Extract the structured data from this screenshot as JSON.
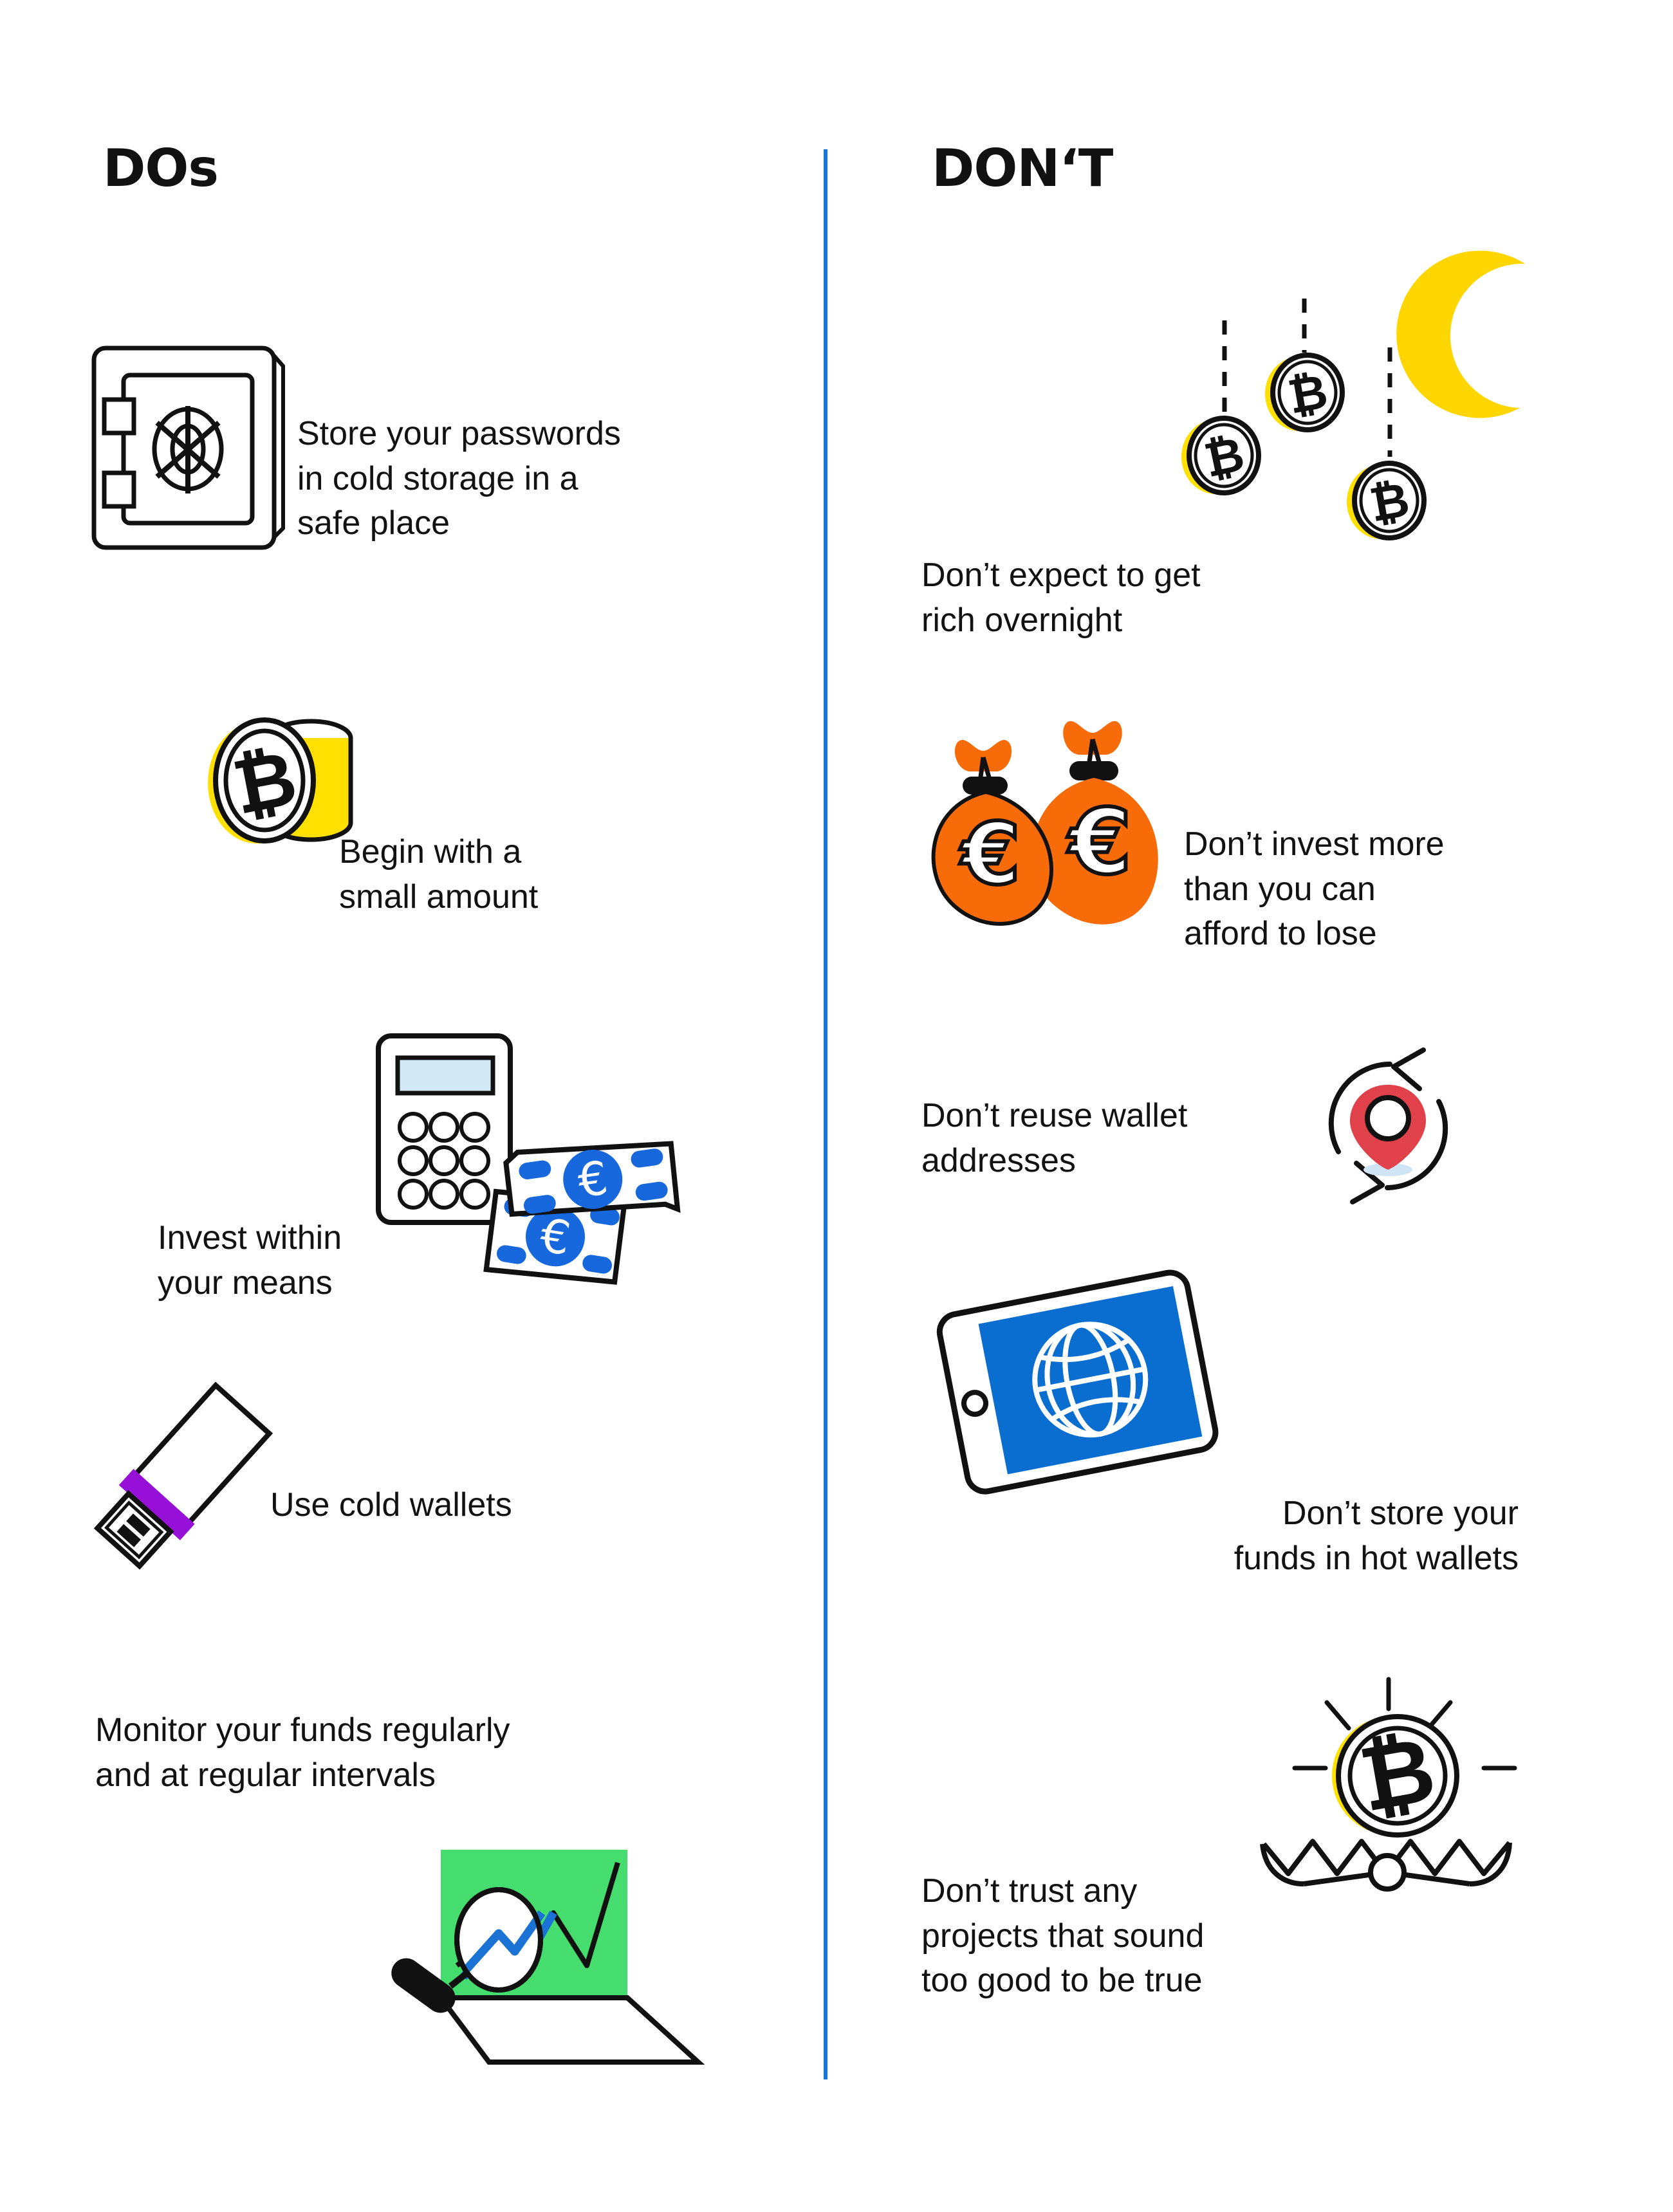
{
  "page": {
    "background": "#ffffff",
    "divider_color": "#1877d2"
  },
  "columns": {
    "left": {
      "title": "DOs"
    },
    "right": {
      "title": "DON‘T"
    }
  },
  "palette": {
    "bitcoin_yellow": "#ffe000",
    "moon_yellow": "#ffd600",
    "money_bag_orange": "#f76b09",
    "euro_blue": "#1668dc",
    "tablet_blue": "#0a6ed1",
    "chart_green": "#45dd6e",
    "chart_line_blue": "#1a73d4",
    "usb_purple": "#9610d8",
    "pin_red": "#e0414a",
    "calc_screen_blue": "#d3e9f5",
    "ink": "#121212"
  },
  "dos": [
    {
      "id": "store-passwords",
      "icon": "safe-icon",
      "text": "Store your passwords\nin cold storage in a\nsafe place"
    },
    {
      "id": "begin-small",
      "icon": "bitcoin-coin-stack-icon",
      "text": "Begin with a\nsmall amount"
    },
    {
      "id": "invest-within-means",
      "icon": "calculator-banknotes-icon",
      "text": "Invest within\nyour means"
    },
    {
      "id": "cold-wallets",
      "icon": "usb-drive-icon",
      "text": "Use cold wallets"
    },
    {
      "id": "monitor-funds",
      "icon": "laptop-chart-magnifier-icon",
      "text": "Monitor your funds regularly\nand at regular intervals"
    }
  ],
  "donts": [
    {
      "id": "rich-overnight",
      "icon": "falling-bitcoins-moon-icon",
      "text": "Don’t expect to get\nrich overnight"
    },
    {
      "id": "invest-more",
      "icon": "euro-money-bags-icon",
      "text": "Don’t invest more\nthan you can\nafford to lose"
    },
    {
      "id": "reuse-addresses",
      "icon": "location-pin-refresh-icon",
      "text": "Don’t reuse wallet\naddresses"
    },
    {
      "id": "hot-wallets",
      "icon": "tablet-globe-icon",
      "text": "Don’t store your\nfunds in hot wallets"
    },
    {
      "id": "too-good-to-be-true",
      "icon": "bitcoin-bear-trap-icon",
      "text": "Don’t trust any\nprojects that sound\ntoo good to be true"
    }
  ]
}
